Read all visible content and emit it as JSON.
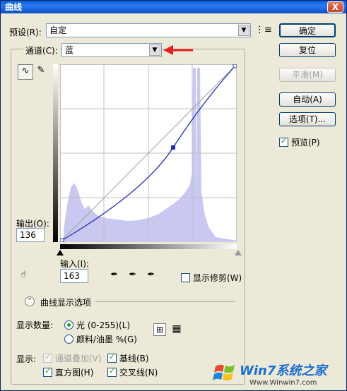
{
  "window": {
    "title": "曲线",
    "close": "X"
  },
  "preset": {
    "label": "预设(R):",
    "value": "自定"
  },
  "channel": {
    "label": "通道(C):",
    "value": "蓝"
  },
  "buttons": {
    "ok": "确定",
    "reset": "复位",
    "smooth": "平滑(M)",
    "auto": "自动(A)",
    "options": "选项(T)..."
  },
  "preview": {
    "label": "预览(P)",
    "checked": true
  },
  "output": {
    "label": "输出(O):",
    "value": "136"
  },
  "input": {
    "label": "输入(I):",
    "value": "163"
  },
  "show_clipping": {
    "label": "显示修剪(W)",
    "checked": false
  },
  "curve_options": {
    "label": "曲线显示选项"
  },
  "display_amount": {
    "label": "显示数量:",
    "light": "光 (0-255)(L)",
    "pigment": "颜料/油墨 %(G)",
    "selected": "light"
  },
  "show": {
    "label": "显示:",
    "channel_overlay": "通道叠加(V)",
    "baseline": "基线(B)",
    "histogram": "直方图(H)",
    "intersection": "交叉线(N)"
  },
  "watermark": {
    "brand": "Win7系统之家",
    "url": "Www.Winwin7.com"
  },
  "colors": {
    "curve": "#1f2fb5",
    "histogram": "#c8c8f0",
    "arrow": "#e0201e"
  },
  "icons": {
    "menu": "options-menu-icon",
    "curve_tool": "curve-tool-icon",
    "pencil": "pencil-icon",
    "hand": "on-image-adjust-icon"
  }
}
